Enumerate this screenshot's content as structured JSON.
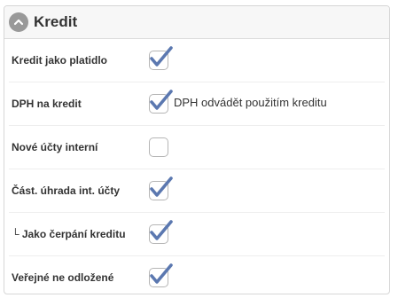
{
  "panel": {
    "title": "Kredit",
    "collapse_icon": "chevron-up-icon",
    "check_color": "#5b78b0"
  },
  "rows": [
    {
      "label": "Kredit jako platidlo",
      "checked": true,
      "text": ""
    },
    {
      "label": "DPH na kredit",
      "checked": true,
      "text": "DPH odvádět použitím kreditu"
    },
    {
      "label": "Nové účty interní",
      "checked": false,
      "text": ""
    },
    {
      "label": "Část. úhrada int. účty",
      "checked": true,
      "text": ""
    },
    {
      "label": "└ Jako čerpání kreditu",
      "checked": true,
      "text": ""
    },
    {
      "label": "Veřejné ne odložené",
      "checked": true,
      "text": ""
    }
  ]
}
